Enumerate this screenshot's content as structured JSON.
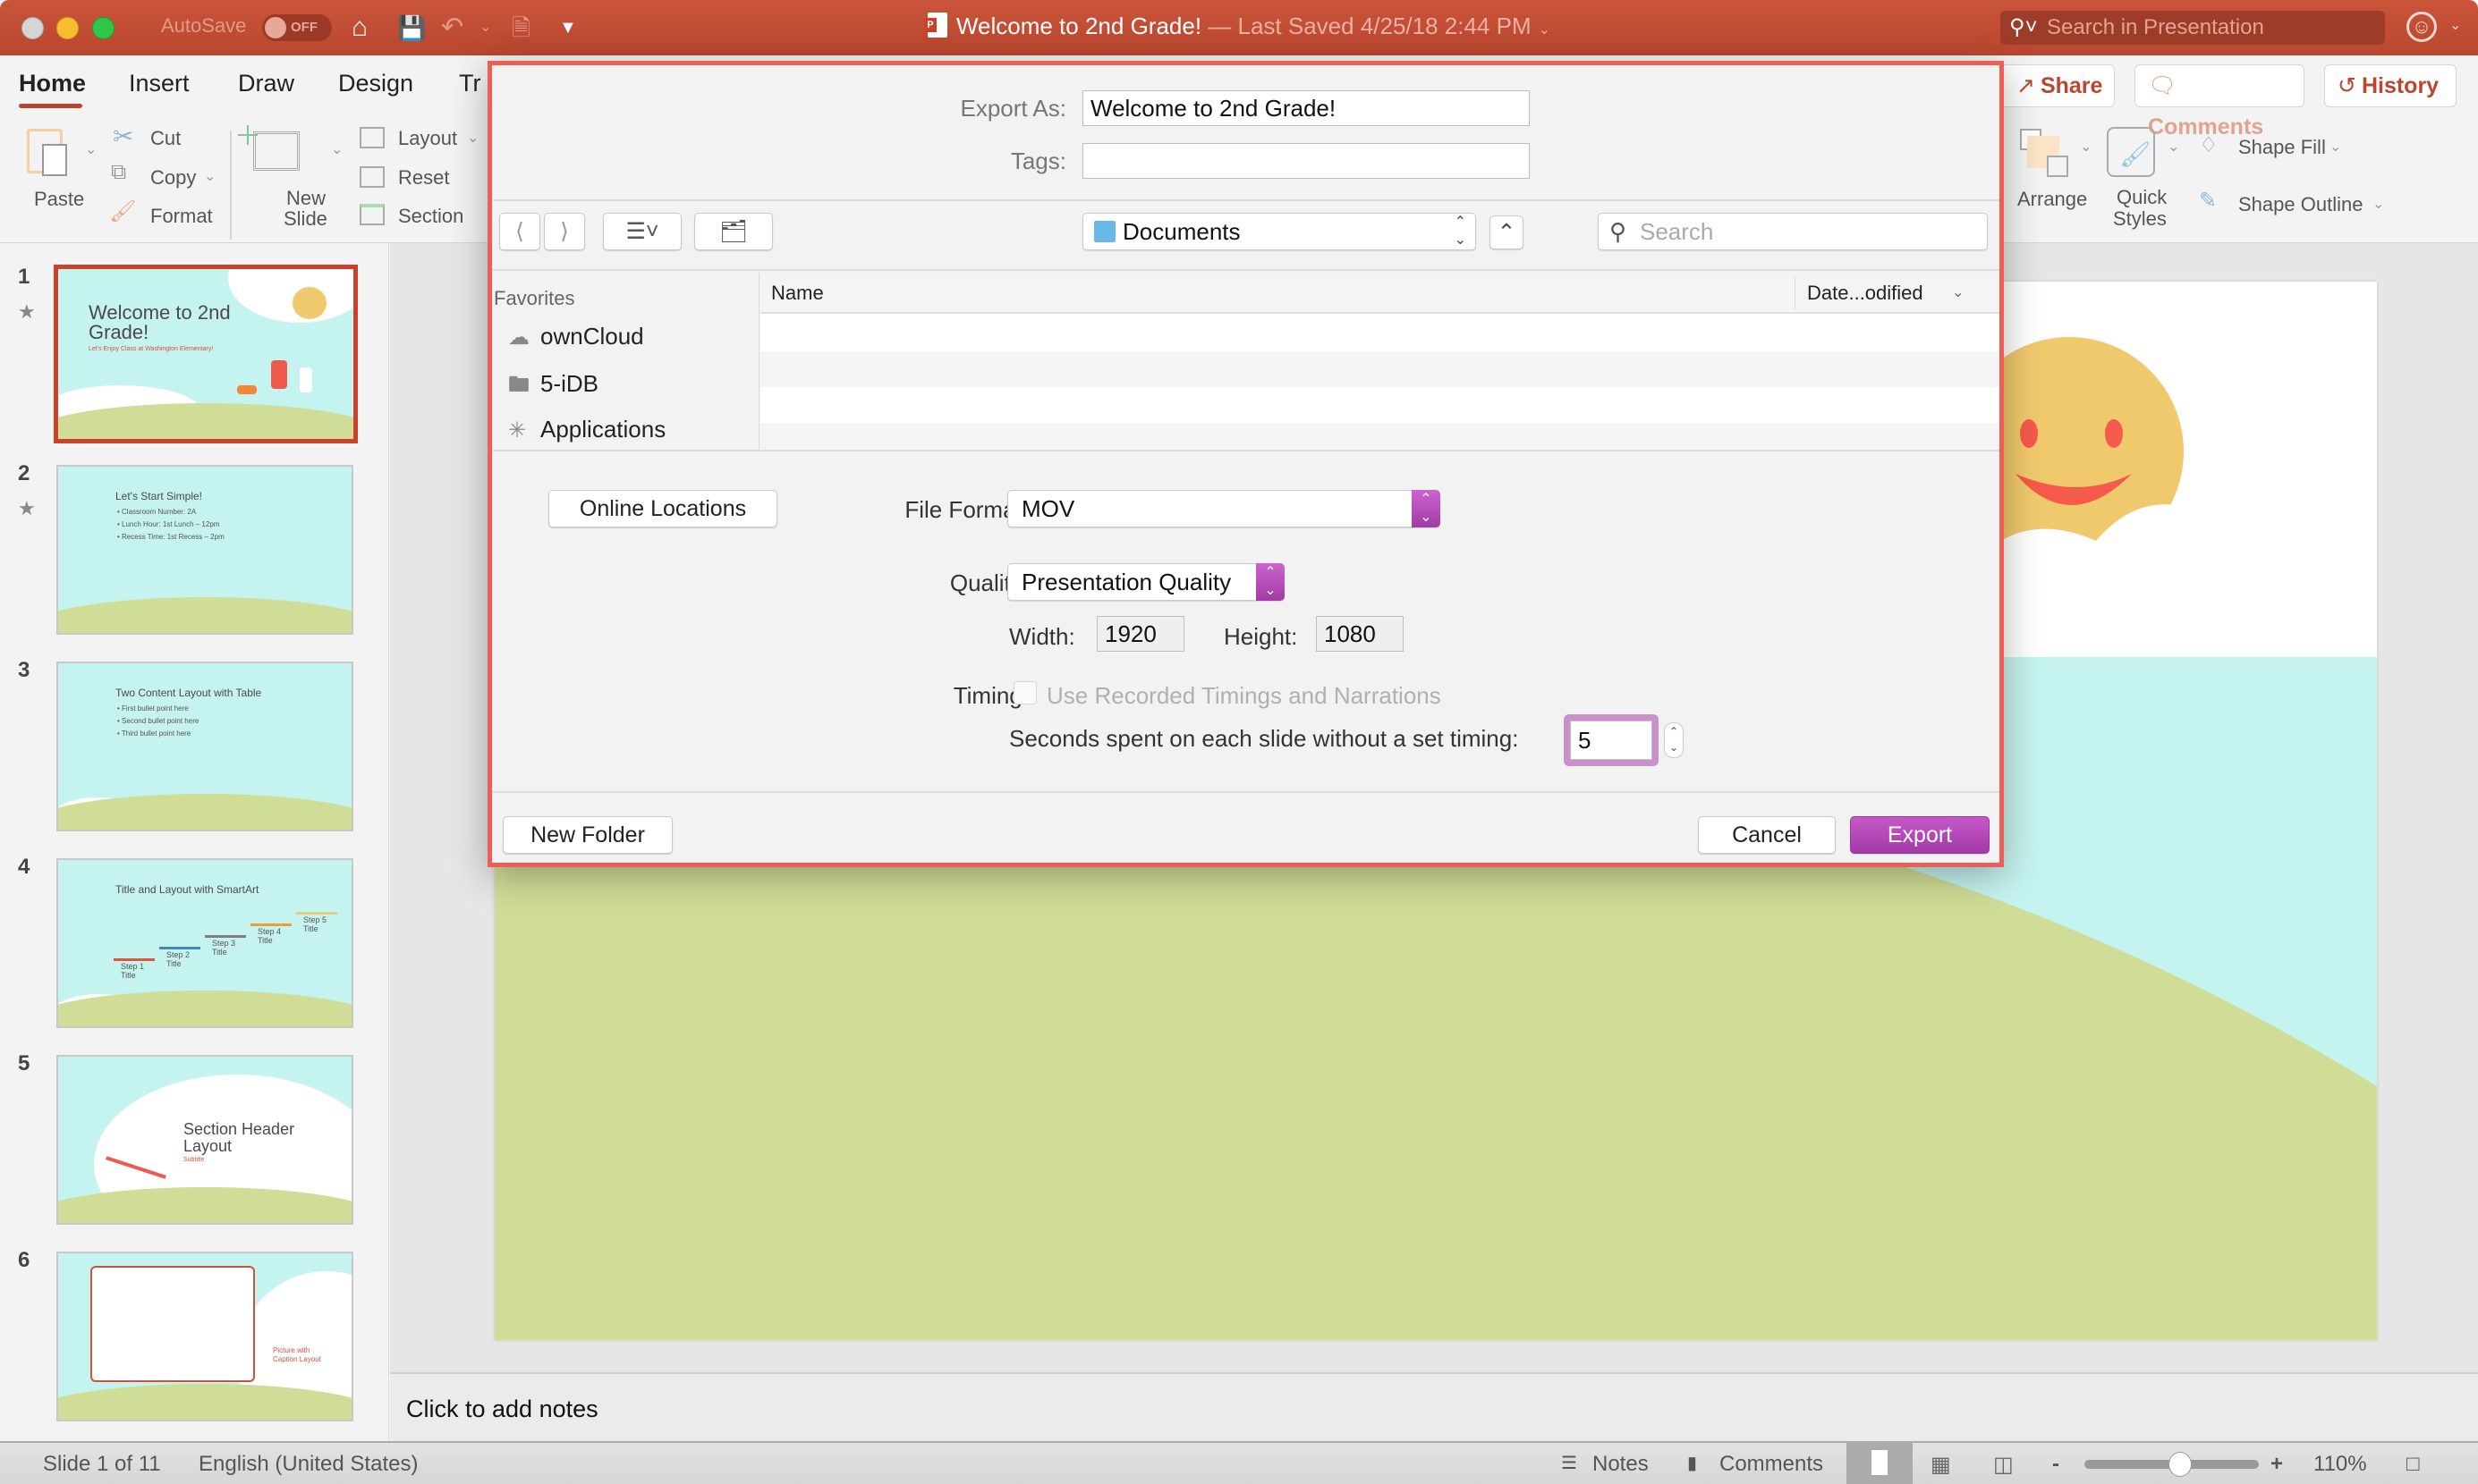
{
  "window": {
    "title": "Welcome to 2nd Grade!",
    "subtitle": " — Last Saved 4/25/18 2:44 PM",
    "autosave_label": "AutoSave",
    "autosave_state": "OFF",
    "search_placeholder": "Search in Presentation"
  },
  "ribbon": {
    "tabs": [
      "Home",
      "Insert",
      "Draw",
      "Design",
      "Tr"
    ],
    "active_tab": "Home",
    "clipboard": {
      "paste": "Paste",
      "cut": "Cut",
      "copy": "Copy",
      "format": "Format"
    },
    "slides": {
      "new_slide_1": "New",
      "new_slide_2": "Slide",
      "layout": "Layout",
      "reset": "Reset",
      "section": "Section"
    },
    "share": "Share",
    "comments": "Comments",
    "history": "History",
    "arrange": "Arrange",
    "quick_styles_1": "Quick",
    "quick_styles_2": "Styles",
    "shape_fill": "Shape Fill",
    "shape_outline": "Shape Outline"
  },
  "thumbnails": [
    {
      "num": "1",
      "title": "Welcome to 2nd Grade!",
      "subtitle": "Let's Enjoy Class at Washington Elementary!",
      "selected": true,
      "has_animation": true
    },
    {
      "num": "2",
      "title": "Let's Start Simple!",
      "bullets": [
        "Classroom Number: 2A",
        "Lunch Hour: 1st Lunch – 12pm",
        "Recess Time: 1st Recess – 2pm"
      ],
      "has_animation": true
    },
    {
      "num": "3",
      "title": "Two Content Layout with Table",
      "bullets": [
        "First bullet point here",
        "Second bullet point here",
        "Third bullet point here"
      ]
    },
    {
      "num": "4",
      "title": "Title and Layout with SmartArt",
      "steps": [
        "Step 1 Title",
        "Step 2 Title",
        "Step 3 Title",
        "Step 4 Title",
        "Step 5 Title"
      ]
    },
    {
      "num": "5",
      "title": "Section Header Layout",
      "subtitle": "Subtitle"
    },
    {
      "num": "6",
      "caption": "Picture with Caption Layout"
    }
  ],
  "notes_placeholder": "Click to add notes",
  "statusbar": {
    "slide_position": "Slide 1 of 11",
    "language": "English (United States)",
    "notes": "Notes",
    "comments": "Comments",
    "zoom": "110%",
    "zoom_fraction": 0.55
  },
  "dialog": {
    "export_as_label": "Export As:",
    "export_as_value": "Welcome to 2nd Grade!",
    "tags_label": "Tags:",
    "tags_value": "",
    "location": "Documents",
    "search_placeholder": "Search",
    "favorites_header": "Favorites",
    "favorites": [
      {
        "label": "ownCloud",
        "icon": "cloud-icon"
      },
      {
        "label": "5-iDB",
        "icon": "folder-icon"
      },
      {
        "label": "Applications",
        "icon": "applications-icon"
      }
    ],
    "columns": {
      "name": "Name",
      "date": "Date...odified"
    },
    "online_locations": "Online Locations",
    "file_format_label": "File Format:",
    "file_format_value": "MOV",
    "quality_label": "Quality:",
    "quality_value": "Presentation Quality",
    "width_label": "Width:",
    "width_value": "1920",
    "height_label": "Height:",
    "height_value": "1080",
    "timing_label": "Timing:",
    "use_recorded_label": "Use Recorded Timings and Narrations",
    "use_recorded_checked": false,
    "seconds_label": "Seconds spent on each slide without a set timing:",
    "seconds_value": "5",
    "new_folder": "New Folder",
    "cancel": "Cancel",
    "export": "Export"
  },
  "colors": {
    "titlebar": "#c0492f",
    "accent": "#b9472f",
    "dialog_border": "#ef5d57",
    "export_button": "#b347b6",
    "slide_sky": "#c5f3ef",
    "slide_grass": "#cfdd97"
  }
}
